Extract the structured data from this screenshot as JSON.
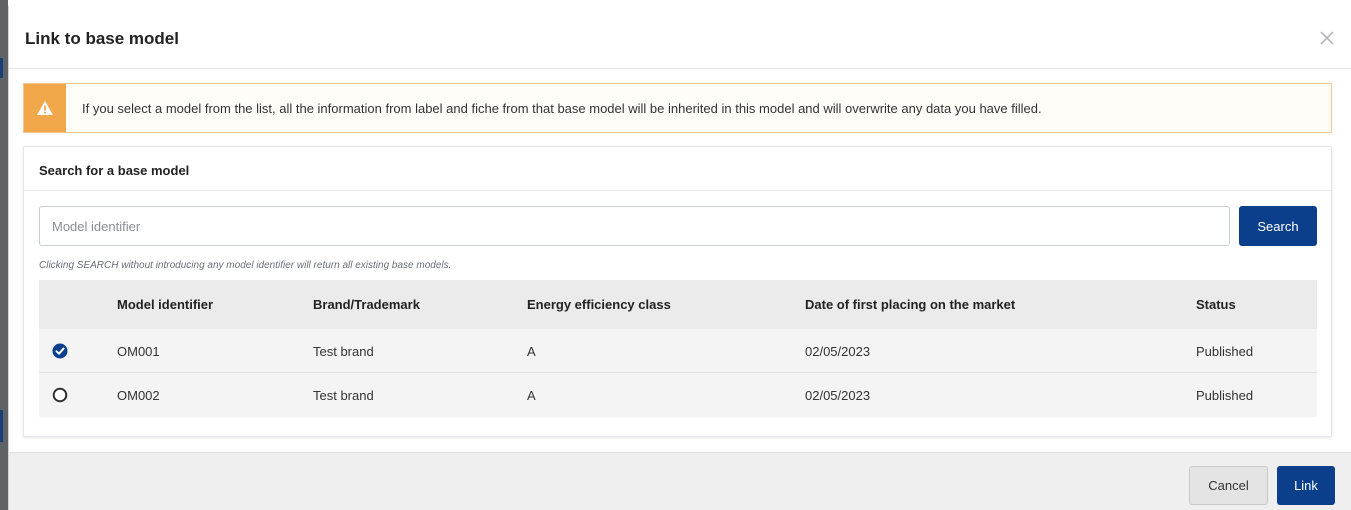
{
  "dialog": {
    "title": "Link to base model",
    "close_icon": "close-icon"
  },
  "alert": {
    "icon": "warning-icon",
    "message": "If you select a model from the list, all the information from label and fiche from that base model will be inherited in this model and will overwrite any data you have filled."
  },
  "search_panel": {
    "title": "Search for a base model",
    "input_value": "",
    "input_placeholder": "Model identifier",
    "search_label": "Search",
    "hint": "Clicking SEARCH without introducing any model identifier will return all existing base models."
  },
  "table": {
    "columns": [
      "Model identifier",
      "Brand/Trademark",
      "Energy efficiency class",
      "Date of first placing on the market",
      "Status"
    ],
    "rows": [
      {
        "selected": true,
        "model_identifier": "OM001",
        "brand": "Test brand",
        "energy_class": "A",
        "date": "02/05/2023",
        "status": "Published"
      },
      {
        "selected": false,
        "model_identifier": "OM002",
        "brand": "Test brand",
        "energy_class": "A",
        "date": "02/05/2023",
        "status": "Published"
      }
    ]
  },
  "footer": {
    "cancel_label": "Cancel",
    "link_label": "Link"
  },
  "colors": {
    "primary": "#0b3f8c",
    "warning": "#f0a84a"
  }
}
